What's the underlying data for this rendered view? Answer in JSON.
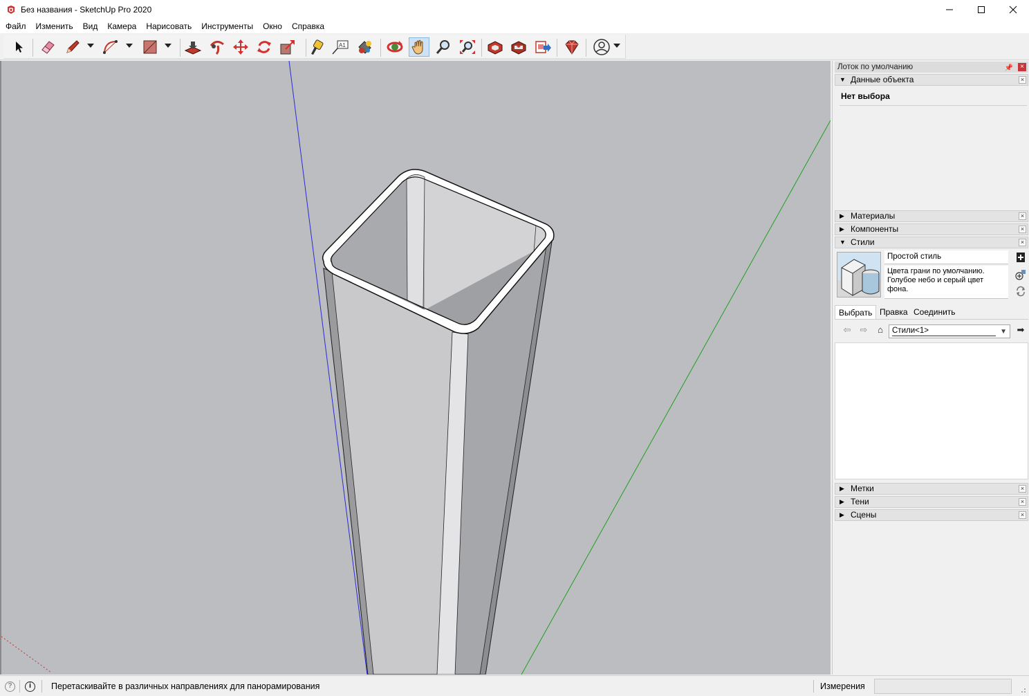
{
  "window": {
    "title": "Без названия - SketchUp Pro 2020",
    "controls": [
      "minimize-icon",
      "maximize-icon",
      "close-icon"
    ]
  },
  "menu": [
    "Файл",
    "Изменить",
    "Вид",
    "Камера",
    "Нарисовать",
    "Инструменты",
    "Окно",
    "Справка"
  ],
  "toolbar": {
    "tools": [
      {
        "name": "select-tool",
        "icon": "arrow-cursor-icon"
      },
      {
        "name": "eraser-tool",
        "icon": "eraser-icon"
      },
      {
        "name": "line-tool",
        "icon": "pencil-icon"
      },
      {
        "name": "arc-tool",
        "icon": "arc-icon"
      },
      {
        "name": "rectangle-tool",
        "icon": "rectangle-icon"
      },
      {
        "name": "push-pull-tool",
        "icon": "push-pull-icon"
      },
      {
        "name": "follow-me-tool",
        "icon": "follow-me-icon"
      },
      {
        "name": "move-tool",
        "icon": "move-icon"
      },
      {
        "name": "rotate-tool",
        "icon": "rotate-icon"
      },
      {
        "name": "scale-tool",
        "icon": "scale-icon"
      },
      {
        "name": "tape-measure-tool",
        "icon": "tape-measure-icon"
      },
      {
        "name": "text-tool",
        "icon": "text-icon",
        "label": "A1"
      },
      {
        "name": "paint-bucket-tool",
        "icon": "paint-bucket-icon"
      },
      {
        "name": "orbit-tool",
        "icon": "orbit-icon"
      },
      {
        "name": "pan-tool",
        "icon": "pan-hand-icon",
        "active": true
      },
      {
        "name": "zoom-tool",
        "icon": "zoom-icon"
      },
      {
        "name": "zoom-extents-tool",
        "icon": "zoom-extents-icon"
      },
      {
        "name": "warehouse-tool",
        "icon": "3d-warehouse-icon"
      },
      {
        "name": "extension-warehouse-tool",
        "icon": "extension-warehouse-icon"
      },
      {
        "name": "layout-send-tool",
        "icon": "send-to-layout-icon"
      },
      {
        "name": "extension-manager-tool",
        "icon": "ruby-gem-icon"
      },
      {
        "name": "account-tool",
        "icon": "user-account-icon"
      }
    ]
  },
  "tray": {
    "title": "Лоток по умолчанию",
    "entity_info": {
      "header": "Данные объекта",
      "no_selection": "Нет выбора"
    },
    "materials": "Материалы",
    "components": "Компоненты",
    "styles": {
      "header": "Стили",
      "style_name": "Простой стиль",
      "style_description": "Цвета грани по умолчанию. Голубое небо и серый цвет фона.",
      "tabs": [
        "Выбрать",
        "Правка",
        "Соединить"
      ],
      "collection": "Стили<1>"
    },
    "tags": "Метки",
    "shadows": "Тени",
    "scenes": "Сцены"
  },
  "statusbar": {
    "hint": "Перетаскивайте в различных направлениях для панорамирования",
    "measurements_label": "Измерения",
    "measurements_value": ""
  },
  "colors": {
    "viewport_bg": "#bcbdc1",
    "blue_axis": "#2a2ad6",
    "green_axis": "#1ea01e",
    "red_axis": "#c83030",
    "active_tool": "#cde3f5"
  }
}
